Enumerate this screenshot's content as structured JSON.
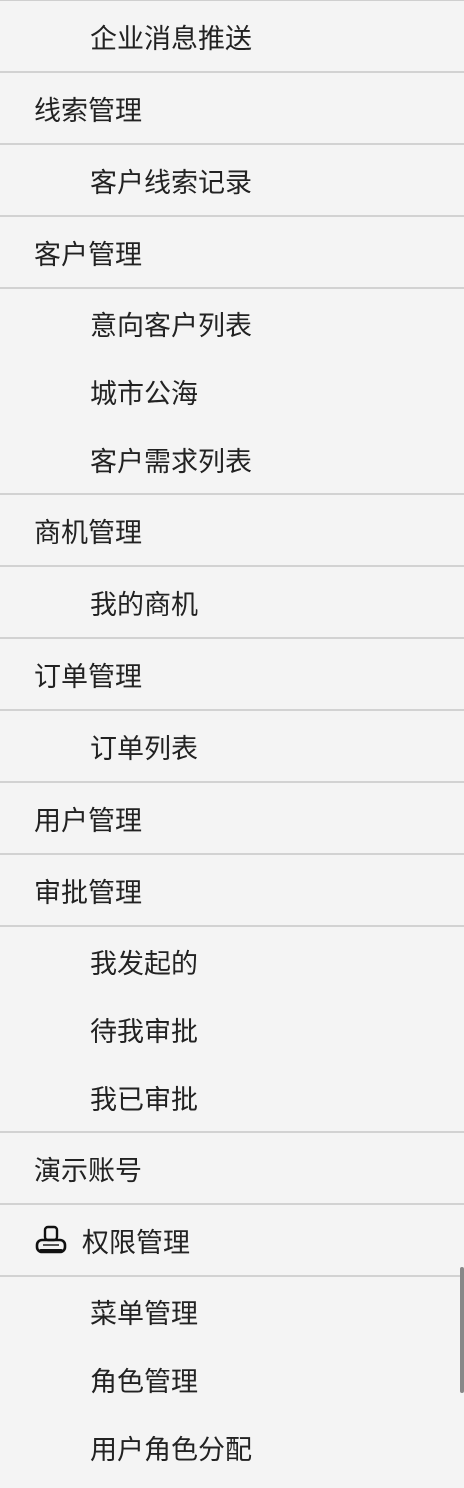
{
  "menu": {
    "top_item": "企业消息推送",
    "groups": [
      {
        "title": "线索管理",
        "items": [
          "客户线索记录"
        ]
      },
      {
        "title": "客户管理",
        "items": [
          "意向客户列表",
          "城市公海",
          "客户需求列表"
        ]
      },
      {
        "title": "商机管理",
        "items": [
          "我的商机"
        ]
      },
      {
        "title": "订单管理",
        "items": [
          "订单列表"
        ]
      },
      {
        "title": "用户管理",
        "items": []
      },
      {
        "title": "审批管理",
        "items": [
          "我发起的",
          "待我审批",
          "我已审批"
        ]
      },
      {
        "title": "演示账号",
        "items": []
      },
      {
        "title": "权限管理",
        "icon": "stamp-icon",
        "items": [
          "菜单管理",
          "角色管理",
          "用户角色分配"
        ]
      }
    ]
  }
}
